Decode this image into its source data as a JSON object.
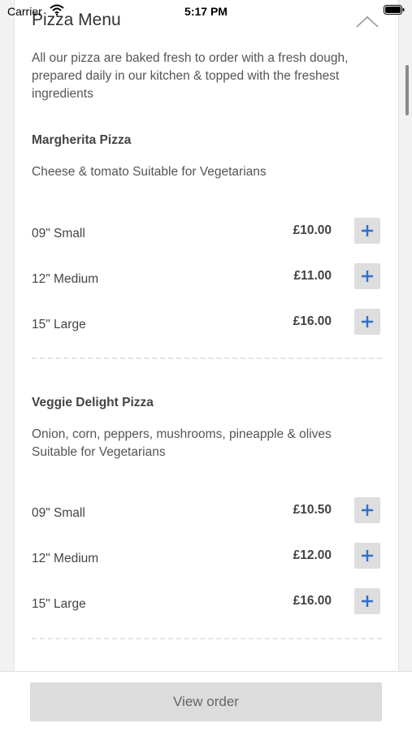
{
  "status_bar": {
    "carrier": "Carrier",
    "time": "5:17 PM"
  },
  "menu": {
    "title": "Pizza Menu",
    "intro": "All our pizza are baked fresh to order with a fresh dough, prepared daily in our kitchen & topped with the freshest ingredients"
  },
  "pizzas": [
    {
      "name": "Margherita Pizza",
      "description": "Cheese & tomato Suitable for Vegetarians",
      "sizes": [
        {
          "label": "09\" Small",
          "price": "£10.00"
        },
        {
          "label": "12\" Medium",
          "price": "£11.00"
        },
        {
          "label": "15\" Large",
          "price": "£16.00"
        }
      ]
    },
    {
      "name": "Veggie Delight Pizza",
      "description": "Onion, corn, peppers, mushrooms, pineapple & olives Suitable for Vegetarians",
      "sizes": [
        {
          "label": "09\" Small",
          "price": "£10.50"
        },
        {
          "label": "12\" Medium",
          "price": "£12.00"
        },
        {
          "label": "15\" Large",
          "price": "£16.00"
        }
      ]
    }
  ],
  "footer": {
    "view_order_label": "View order"
  },
  "colors": {
    "accent": "#2f6fcb",
    "button_bg": "#dedede"
  },
  "icons": {
    "add": "plus-icon",
    "collapse": "chevron-up-icon",
    "wifi": "wifi-icon",
    "battery": "battery-icon"
  }
}
